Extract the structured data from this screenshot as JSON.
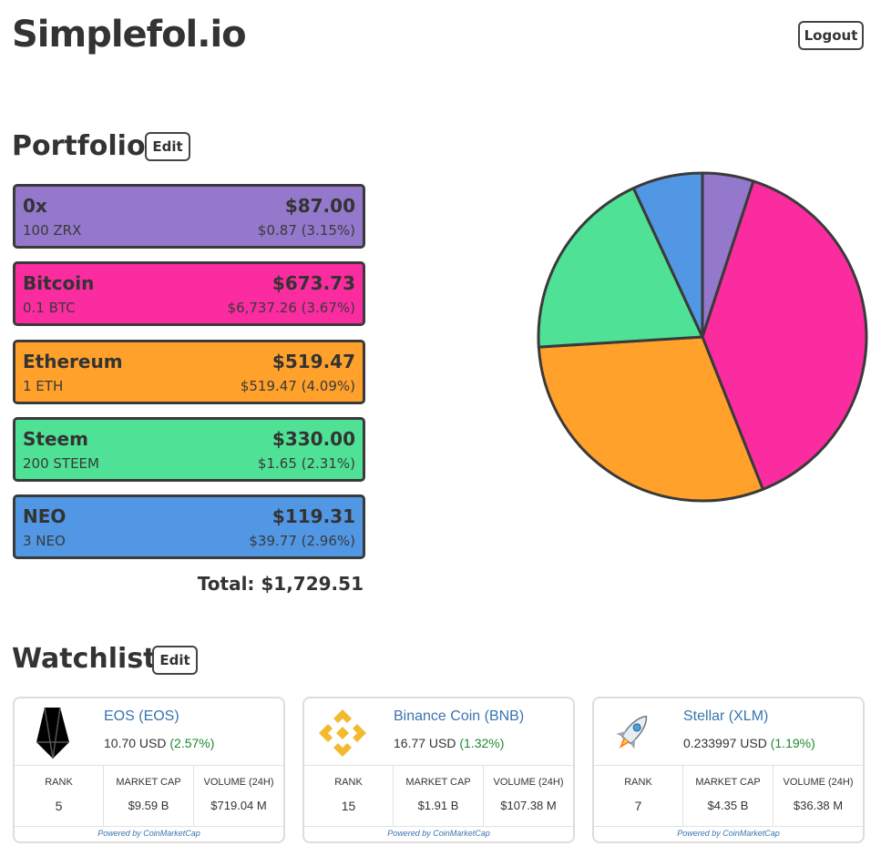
{
  "app": {
    "title": "Simplefol.io",
    "logout_label": "Logout"
  },
  "portfolio": {
    "title": "Portfolio",
    "edit_label": "Edit",
    "holdings": [
      {
        "name": "0x",
        "value": "$87.00",
        "amount": "100 ZRX",
        "price": "$0.87 (3.15%)",
        "color": "#9478cc"
      },
      {
        "name": "Bitcoin",
        "value": "$673.73",
        "amount": "0.1 BTC",
        "price": "$6,737.26 (3.67%)",
        "color": "#fb2ba0"
      },
      {
        "name": "Ethereum",
        "value": "$519.47",
        "amount": "1 ETH",
        "price": "$519.47 (4.09%)",
        "color": "#ffa12b"
      },
      {
        "name": "Steem",
        "value": "$330.00",
        "amount": "200 STEEM",
        "price": "$1.65 (2.31%)",
        "color": "#4fe195"
      },
      {
        "name": "NEO",
        "value": "$119.31",
        "amount": "3 NEO",
        "price": "$39.77 (2.96%)",
        "color": "#5197e3"
      }
    ],
    "total": "Total: $1,729.51"
  },
  "chart_data": {
    "type": "pie",
    "categories": [
      "0x",
      "Bitcoin",
      "Ethereum",
      "Steem",
      "NEO"
    ],
    "values": [
      87.0,
      673.73,
      519.47,
      330.0,
      119.31
    ],
    "colors": [
      "#9478cc",
      "#fb2ba0",
      "#ffa12b",
      "#4fe195",
      "#5197e3"
    ],
    "start": "top",
    "direction": "clockwise"
  },
  "watchlist": {
    "title": "Watchlist",
    "edit_label": "Edit",
    "items": [
      {
        "name": "EOS (EOS)",
        "price": "10.70 USD",
        "change": "(2.57%)",
        "icon": "eos-logo-icon",
        "rank_label": "RANK",
        "rank": "5",
        "cap_label": "MARKET CAP",
        "cap": "$9.59 B",
        "vol_label": "VOLUME (24H)",
        "vol": "$719.04 M",
        "powered": "Powered by CoinMarketCap"
      },
      {
        "name": "Binance Coin (BNB)",
        "price": "16.77 USD",
        "change": "(1.32%)",
        "icon": "binance-logo-icon",
        "rank_label": "RANK",
        "rank": "15",
        "cap_label": "MARKET CAP",
        "cap": "$1.91 B",
        "vol_label": "VOLUME (24H)",
        "vol": "$107.38 M",
        "powered": "Powered by CoinMarketCap"
      },
      {
        "name": "Stellar (XLM)",
        "price": "0.233997 USD",
        "change": "(1.19%)",
        "icon": "stellar-rocket-icon",
        "rank_label": "RANK",
        "rank": "7",
        "cap_label": "MARKET CAP",
        "cap": "$4.35 B",
        "vol_label": "VOLUME (24H)",
        "vol": "$36.38 M",
        "powered": "Powered by CoinMarketCap"
      }
    ]
  }
}
